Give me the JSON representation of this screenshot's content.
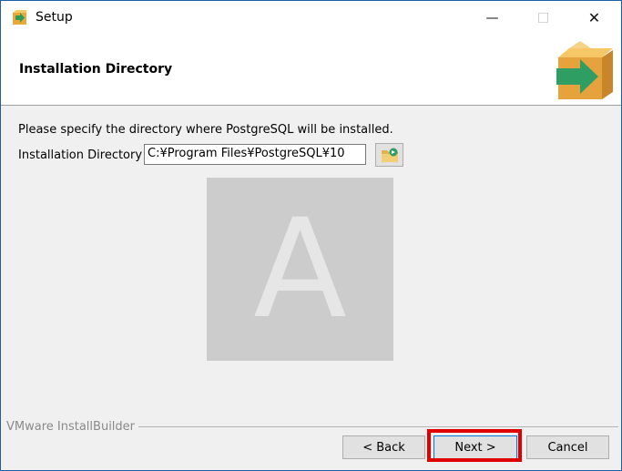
{
  "window": {
    "title": "Setup",
    "minimize_glyph": "—",
    "maximize_glyph": "☐",
    "close_glyph": "✕"
  },
  "header": {
    "title": "Installation Directory",
    "icon": "box-arrow-icon"
  },
  "main": {
    "description": "Please specify the directory where PostgreSQL will be installed.",
    "dir_label": "Installation Directory",
    "dir_value": "C:¥Program Files¥PostgreSQL¥10",
    "browse_icon": "folder-browse-icon",
    "placeholder_letter": "A"
  },
  "footer": {
    "branding": "VMware InstallBuilder",
    "back_label": "< Back",
    "next_label": "Next >",
    "cancel_label": "Cancel",
    "highlight_color": "#e00000"
  }
}
